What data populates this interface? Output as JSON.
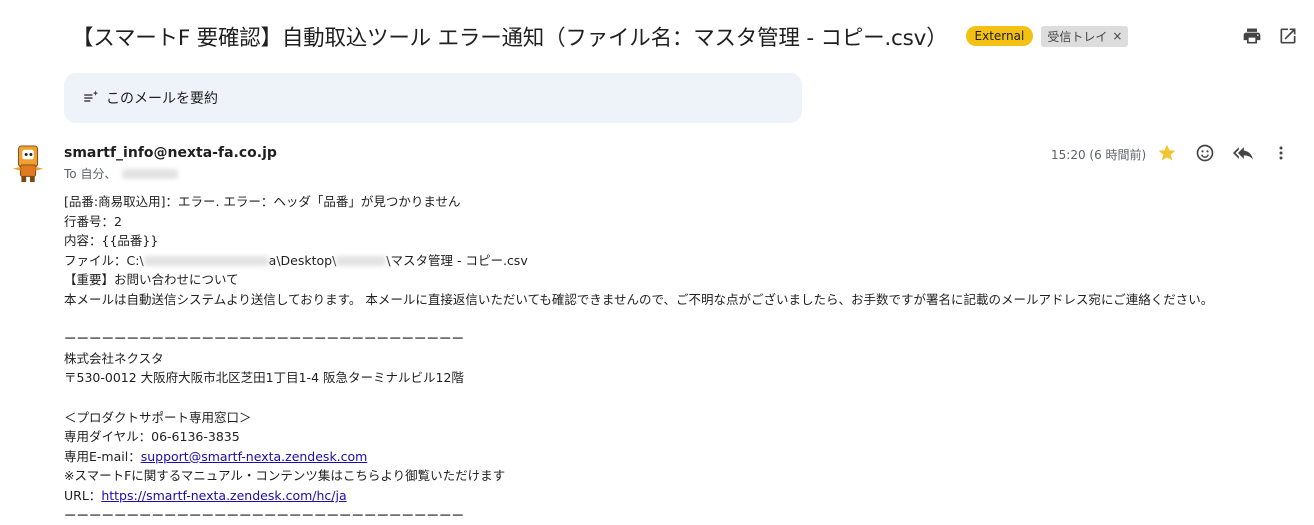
{
  "email": {
    "subject": "【スマートF 要確認】自動取込ツール エラー通知（ファイル名：マスタ管理 - コピー.csv）",
    "labels": {
      "external": "External",
      "inbox": "受信トレイ",
      "inbox_remove": "×"
    },
    "summary_label": "このメールを要約",
    "sender": "smartf_info@nexta-fa.co.jp",
    "to_prefix": "To 自分、",
    "time": "15:20 (6 時間前)"
  },
  "body": {
    "line1": "[品番:商易取込用]：エラー. エラー：ヘッダ「品番」が見つかりません",
    "line2": "行番号：2",
    "line3": "内容：{{品番}}",
    "file_prefix": "ファイル：C:\\",
    "file_mid": "a\\Desktop\\",
    "file_suffix": "\\マスタ管理 - コピー.csv",
    "line5": "【重要】お問い合わせについて",
    "line6": "本メールは自動送信システムより送信しております。 本メールに直接返信いただいても確認できませんので、ご不明な点がございましたら、お手数ですが署名に記載のメールアドレス宛にご連絡ください。",
    "divider": "ーーーーーーーーーーーーーーーーーーーーーーーーーーーーーーーー",
    "company": "株式会社ネクスタ",
    "address": "〒530-0012 大阪府大阪市北区芝田1丁目1-4 阪急ターミナルビル12階",
    "support_title": "＜プロダクトサポート専用窓口＞",
    "dial": "専用ダイヤル：06-6136-3835",
    "email_prefix": "専用E-mail：",
    "email_link": "support@smartf-nexta.zendesk.com",
    "manual_note": "※スマートFに関するマニュアル・コンテンツ集はこちらより御覧いただけます",
    "url_prefix": "URL：",
    "url_link": "https://smartf-nexta.zendesk.com/hc/ja"
  },
  "colors": {
    "external_chip": "#f2c114",
    "star": "#f4b400",
    "link": "#1a0dab",
    "summary_bg": "#eef2f9"
  },
  "icons": [
    "print-icon",
    "open-in-new-icon",
    "summarize-icon",
    "star-icon",
    "emoji-icon",
    "reply-all-icon",
    "more-vert-icon"
  ]
}
